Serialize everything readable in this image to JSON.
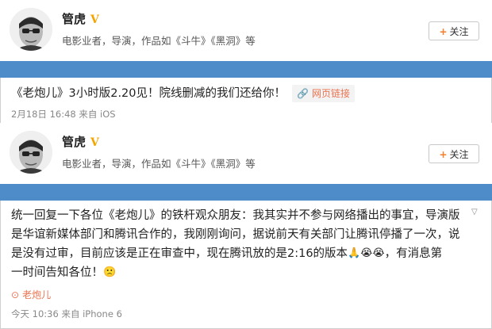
{
  "posts": [
    {
      "user": {
        "name": "管虎",
        "verified": "V",
        "bio": "电影业者，导演，作品如《斗牛》《黑洞》等"
      },
      "follow_label": "关注",
      "follow_plus": "+",
      "text": "《老炮儿》3小时版2.20见！院线删减的我们还给你！",
      "link_label": "网页链接",
      "meta": "2月18日 16:48 来自 iOS"
    },
    {
      "user": {
        "name": "管虎",
        "verified": "V",
        "bio": "电影业者，导演，作品如《斗牛》《黑洞》等"
      },
      "follow_label": "关注",
      "follow_plus": "+",
      "text_lines": [
        "统一回复一下各位《老炮儿》的铁杆观众朋友：我其实并不参与网络播出的事宜，导演版",
        "是华谊新媒体部门和腾讯合作的，我刚刚询问，据说前天有关部门让腾讯停播了一次，说",
        "是没有过审，目前应该是正在审查中，现在腾讯放的是2:16的版本",
        "，有消息第",
        "一时间告知各位！"
      ],
      "emojis": [
        "🙏",
        "😭",
        "😭"
      ],
      "last_emoji": "🙁",
      "topic_tag": "老炮儿",
      "meta": "今天 10:36 来自 iPhone 6"
    }
  ],
  "colors": {
    "band": "#4d8cc9",
    "accent": "#eb7350",
    "vip": "#f4a400"
  }
}
